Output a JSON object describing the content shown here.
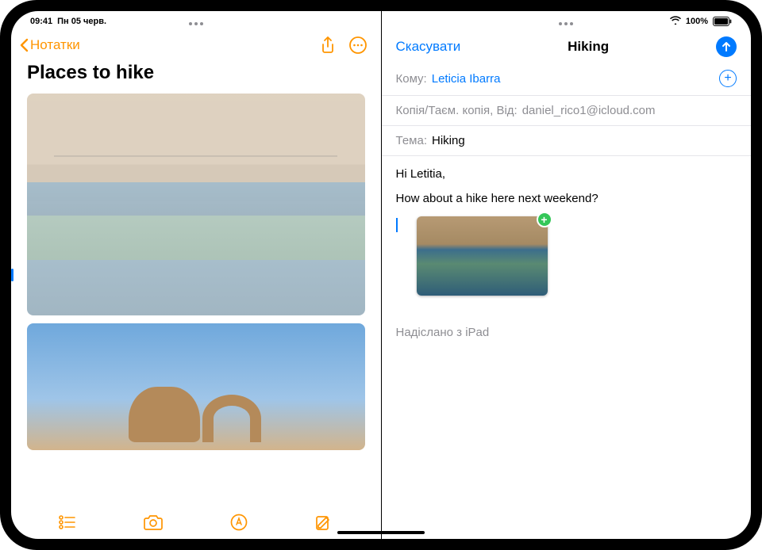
{
  "statusBar": {
    "time": "09:41",
    "date": "Пн 05 черв.",
    "batteryText": "100%"
  },
  "notes": {
    "backLabel": "Нотатки",
    "title": "Places to hike"
  },
  "mail": {
    "cancel": "Скасувати",
    "title": "Hiking",
    "toLabel": "Кому:",
    "recipient": "Leticia Ibarra",
    "ccLabel": "Копія/Таєм. копія, Від:",
    "fromEmail": "daniel_rico1@icloud.com",
    "subjectLabel": "Тема:",
    "subjectValue": "Hiking",
    "bodyLine1": "Hi Letitia,",
    "bodyLine2": "How about a hike here next weekend?",
    "signature": "Надіслано з iPad"
  }
}
